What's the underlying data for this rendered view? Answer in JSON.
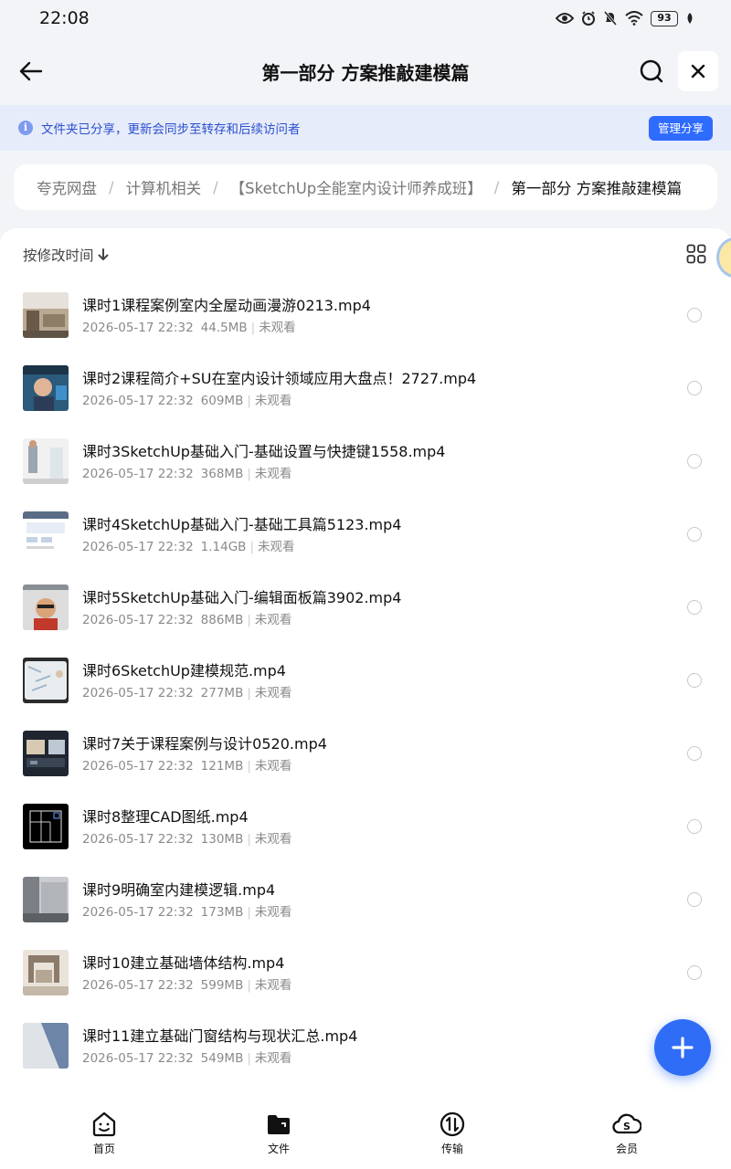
{
  "status_bar": {
    "time": "22:08",
    "battery": "93"
  },
  "header": {
    "title": "第一部分 方案推敲建模篇"
  },
  "share_banner": {
    "text": "文件夹已分享，更新会同步至转存和后续访问者",
    "manage_label": "管理分享"
  },
  "breadcrumb": [
    "夸克网盘",
    "计算机相关",
    "【SketchUp全能室内设计师养成班】",
    "第一部分 方案推敲建模篇"
  ],
  "sort": {
    "label": "按修改时间"
  },
  "files": [
    {
      "name": "课时1课程案例室内全屋动画漫游0213.mp4",
      "date": "2026-05-17 22:32",
      "size": "44.5MB",
      "status": "未观看"
    },
    {
      "name": "课时2课程简介+SU在室内设计领域应用大盘点！2727.mp4",
      "date": "2026-05-17 22:32",
      "size": "609MB",
      "status": "未观看"
    },
    {
      "name": "课时3SketchUp基础入门-基础设置与快捷键1558.mp4",
      "date": "2026-05-17 22:32",
      "size": "368MB",
      "status": "未观看"
    },
    {
      "name": "课时4SketchUp基础入门-基础工具篇5123.mp4",
      "date": "2026-05-17 22:32",
      "size": "1.14GB",
      "status": "未观看"
    },
    {
      "name": "课时5SketchUp基础入门-编辑面板篇3902.mp4",
      "date": "2026-05-17 22:32",
      "size": "886MB",
      "status": "未观看"
    },
    {
      "name": "课时6SketchUp建模规范.mp4",
      "date": "2026-05-17 22:32",
      "size": "277MB",
      "status": "未观看"
    },
    {
      "name": "课时7关于课程案例与设计0520.mp4",
      "date": "2026-05-17 22:32",
      "size": "121MB",
      "status": "未观看"
    },
    {
      "name": "课时8整理CAD图纸.mp4",
      "date": "2026-05-17 22:32",
      "size": "130MB",
      "status": "未观看"
    },
    {
      "name": "课时9明确室内建模逻辑.mp4",
      "date": "2026-05-17 22:32",
      "size": "173MB",
      "status": "未观看"
    },
    {
      "name": "课时10建立基础墙体结构.mp4",
      "date": "2026-05-17 22:32",
      "size": "599MB",
      "status": "未观看"
    },
    {
      "name": "课时11建立基础门窗结构与现状汇总.mp4",
      "date": "2026-05-17 22:32",
      "size": "549MB",
      "status": "未观看"
    }
  ],
  "bottom_nav": {
    "home": "首页",
    "files": "文件",
    "transfer": "传输",
    "member": "会员"
  },
  "colors": {
    "accent": "#2f6df6",
    "banner_bg": "#e7ecfb",
    "banner_text": "#2b4fcf"
  }
}
